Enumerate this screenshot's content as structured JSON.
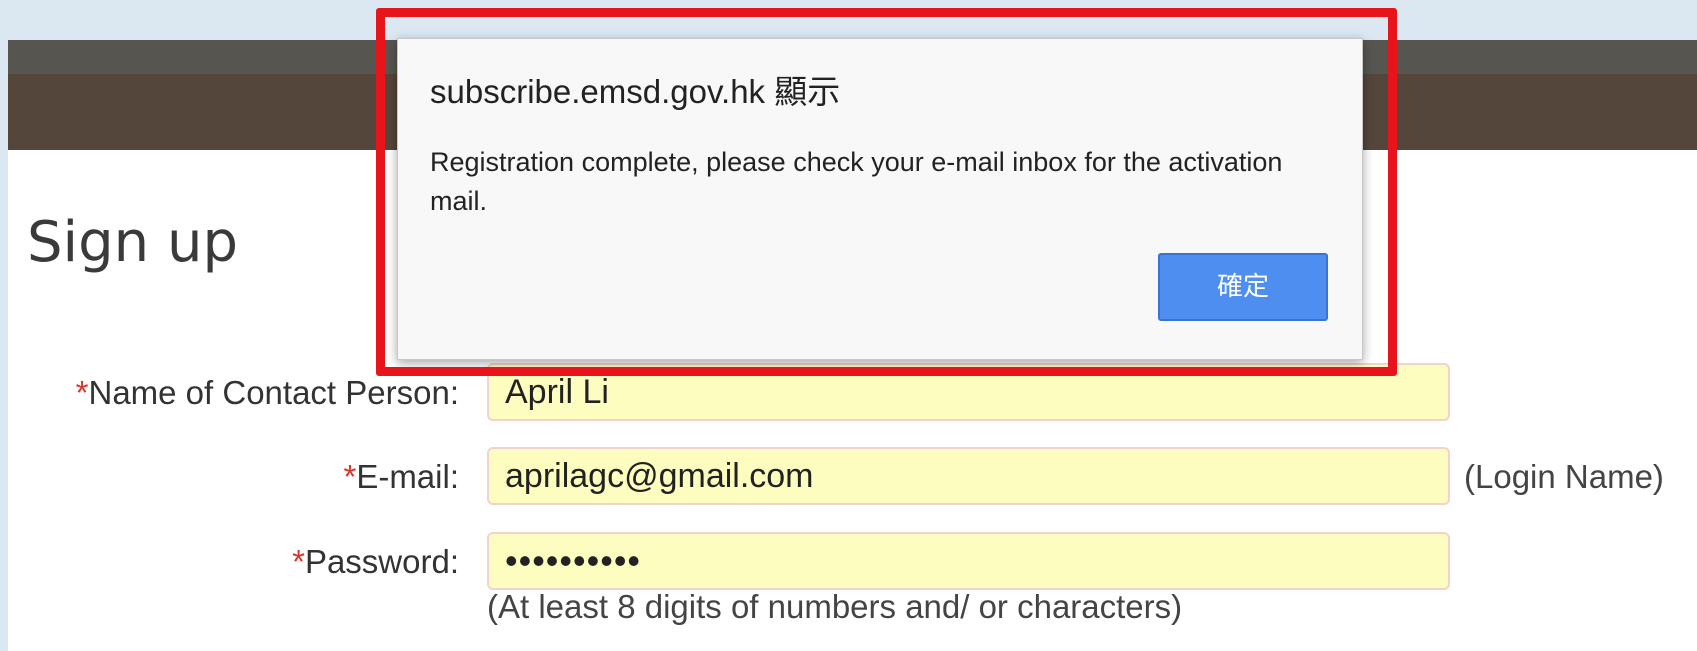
{
  "page": {
    "title": "Sign up"
  },
  "form": {
    "name": {
      "required_mark": "*",
      "label": "Name of Contact Person:",
      "value": "April Li"
    },
    "email": {
      "required_mark": "*",
      "label": "E-mail:",
      "value": "aprilagc@gmail.com",
      "note": "(Login Name)"
    },
    "password": {
      "required_mark": "*",
      "label": "Password:",
      "value": "••••••••••",
      "hint": "(At least 8 digits of numbers and/ or characters)"
    }
  },
  "dialog": {
    "title": "subscribe.emsd.gov.hk 顯示",
    "message": "Registration complete, please check your e-mail inbox for the activation mail.",
    "ok_label": "確定"
  },
  "colors": {
    "header_top": "#575550",
    "header_bar": "#54463a",
    "input_bg": "#fdfdc0",
    "button": "#4e8ef1",
    "highlight": "#e8141b"
  }
}
